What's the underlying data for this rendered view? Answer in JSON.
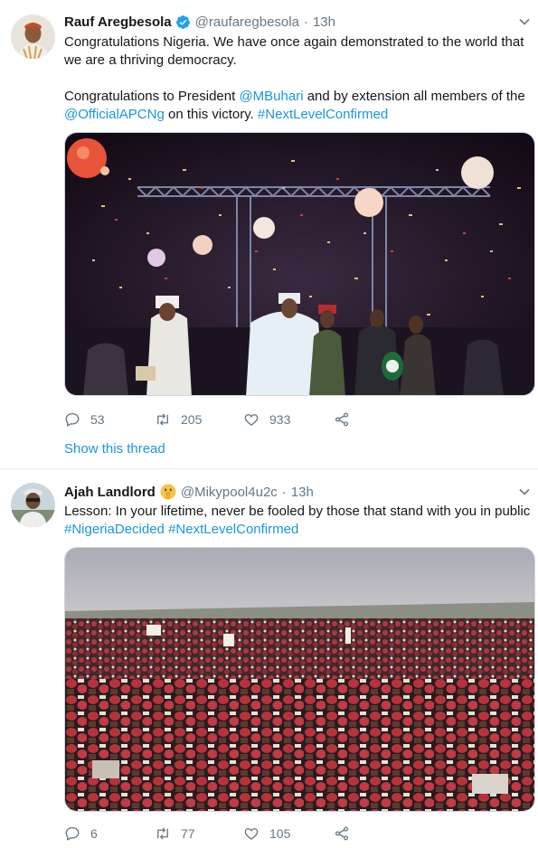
{
  "tweets": [
    {
      "author": "Rauf Aregbesola",
      "handle": "@raufaregbesola",
      "time": "13h",
      "verified": true,
      "text_line1": "Congratulations Nigeria. We have once again demonstrated to the world that",
      "text_line2": "we are a thriving democracy.",
      "text_line3_pre": "Congratulations to President ",
      "mention1": "@MBuhari",
      "text_line3_post": " and by extension all members of the",
      "mention2": "@OfficialAPCNg",
      "text_line4_mid": " on this victory. ",
      "hashtag1": "#NextLevelConfirmed",
      "replies": "53",
      "retweets": "205",
      "likes": "933",
      "show_thread": "Show this thread",
      "image_icon": "stage-confetti-photo"
    },
    {
      "author": "Ajah Landlord",
      "author_emoji": "shushing-face-emoji",
      "handle": "@Mikypool4u2c",
      "time": "13h",
      "text_line1": "Lesson: In your lifetime, never be fooled by those that stand with you in public",
      "hashtag1": "#NigeriaDecided",
      "hashtag2": "#NextLevelConfirmed",
      "replies": "6",
      "retweets": "77",
      "likes": "105",
      "image_icon": "crowd-red-caps-photo"
    }
  ],
  "colors": {
    "link": "#1b95e0",
    "secondary_text": "#657786",
    "primary_text": "#14171a",
    "divider": "#e6ecf0"
  }
}
